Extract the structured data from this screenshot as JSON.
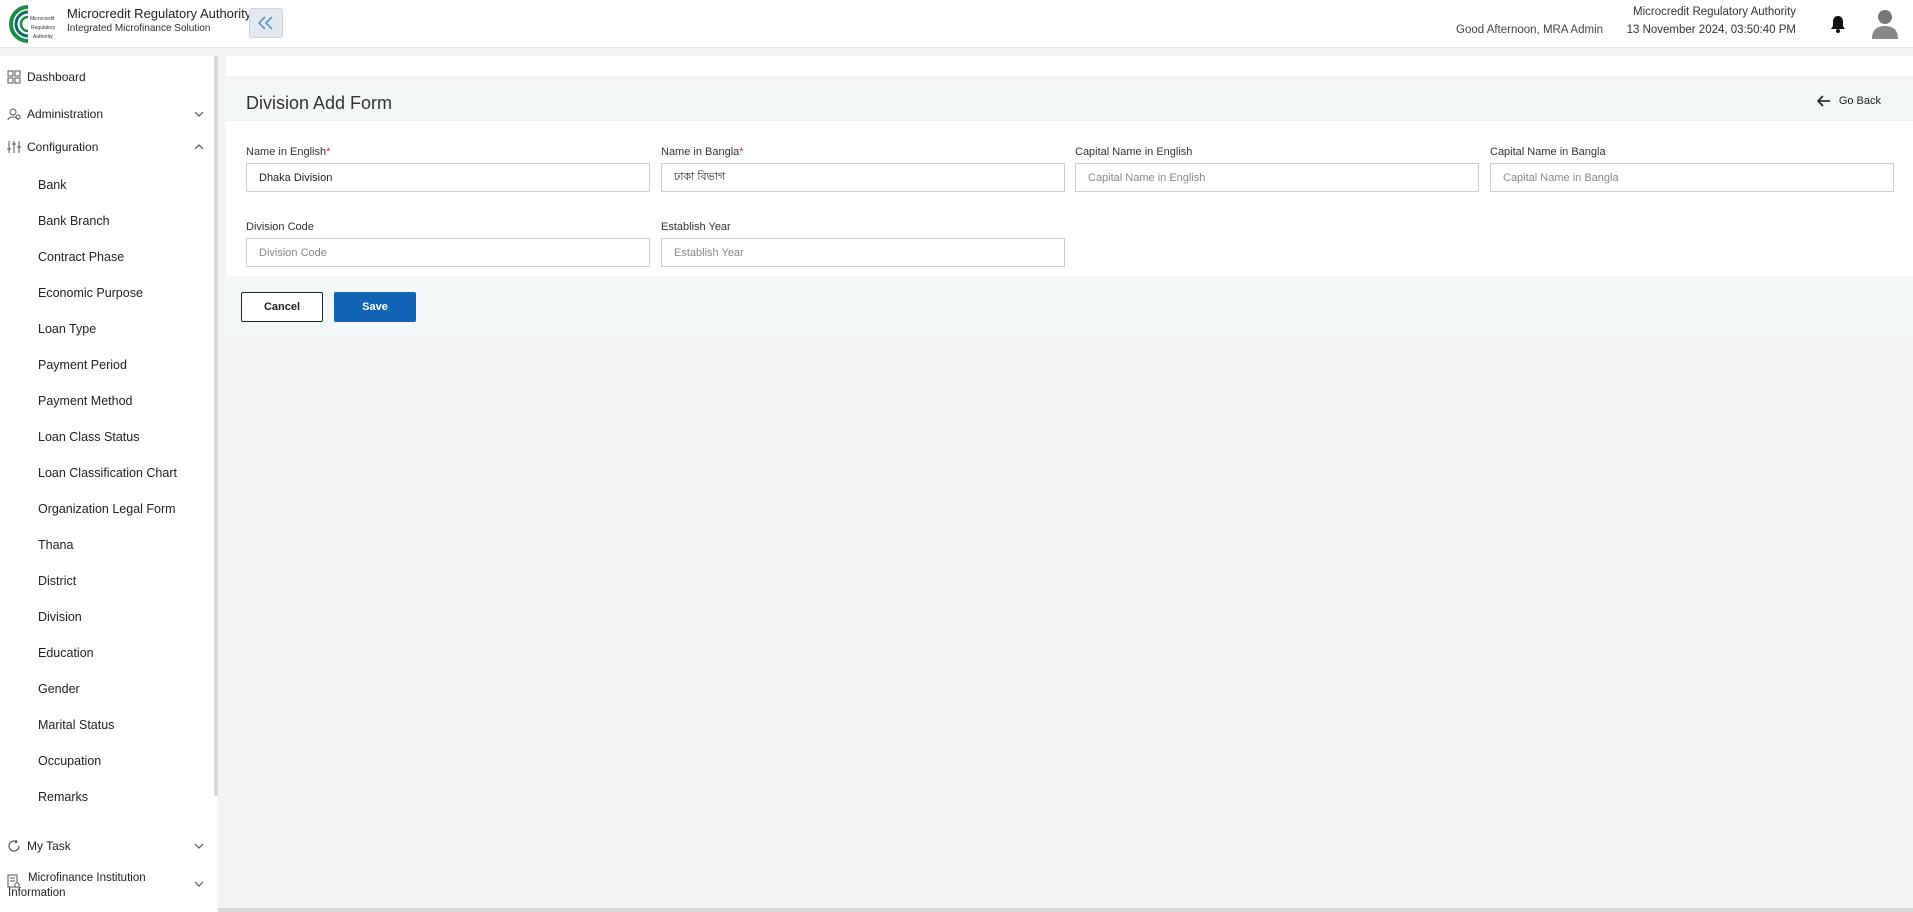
{
  "header": {
    "brand_title": "Microcredit Regulatory Authority",
    "brand_subtitle": "Integrated Microfinance Solution",
    "logo_text": [
      "Microcredit",
      "Regulatory",
      "Authority"
    ],
    "greeting": "Good Afternoon, MRA Admin",
    "org_name": "Microcredit Regulatory Authority",
    "datetime": "13 November 2024, 03:50:40 PM",
    "icons": {
      "collapse": "double-chevron-left-icon",
      "notification": "bell-icon",
      "profile": "user-avatar-icon"
    }
  },
  "sidebar": {
    "dashboard": "Dashboard",
    "administration": "Administration",
    "configuration": "Configuration",
    "config_items": [
      "Bank",
      "Bank Branch",
      "Contract Phase",
      "Economic Purpose",
      "Loan Type",
      "Payment Period",
      "Payment Method",
      "Loan Class Status",
      "Loan Classification Chart",
      "Organization Legal Form",
      "Thana",
      "District",
      "Division",
      "Education",
      "Gender",
      "Marital Status",
      "Occupation",
      "Remarks"
    ],
    "my_task": "My Task",
    "mfi_info": "Microfinance Institution Information"
  },
  "form": {
    "title": "Division Add Form",
    "go_back": "Go Back",
    "required_mark": "*",
    "fields": {
      "name_en": {
        "label": "Name in English",
        "value": "Dhaka Division",
        "placeholder": "Name in English"
      },
      "name_bn": {
        "label": "Name in Bangla",
        "value": "ঢাকা বিভাগ",
        "placeholder": "Name in Bangla"
      },
      "capital_en": {
        "label": "Capital Name in English",
        "value": "",
        "placeholder": "Capital Name in English"
      },
      "capital_bn": {
        "label": "Capital Name in Bangla",
        "value": "",
        "placeholder": "Capital Name in Bangla"
      },
      "division_code": {
        "label": "Division Code",
        "value": "",
        "placeholder": "Division Code"
      },
      "establish_year": {
        "label": "Establish Year",
        "value": "",
        "placeholder": "Establish Year"
      }
    },
    "cancel": "Cancel",
    "save": "Save"
  },
  "colors": {
    "primary": "#1164b4",
    "required": "#d32f2f",
    "logo_green": "#1b8a4a",
    "logo_teal": "#0b6b6b"
  }
}
